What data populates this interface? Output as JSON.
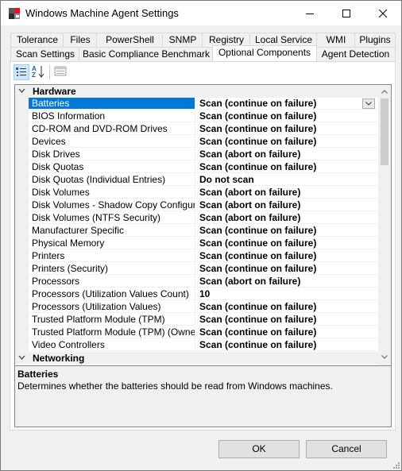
{
  "window": {
    "title": "Windows Machine Agent Settings",
    "icons": {
      "app": "app-icon",
      "minimize": "minimize-icon",
      "maximize": "maximize-icon",
      "close": "close-icon"
    }
  },
  "tabs": {
    "back_row": [
      "Tolerance",
      "Files",
      "PowerShell",
      "SNMP",
      "Registry",
      "Local Service",
      "WMI",
      "Plugins"
    ],
    "front_row": [
      "Scan Settings",
      "Basic Compliance Benchmark",
      "Optional Components",
      "Agent Detection"
    ],
    "active": "Optional Components"
  },
  "toolbar": {
    "categorized_icon": "categorized-view-icon",
    "alphabetical_icon": "alphabetical-sort-icon",
    "property_pages_icon": "property-pages-icon",
    "categorized_active": true
  },
  "property_grid": {
    "categories": [
      {
        "name": "Hardware",
        "expanded": true,
        "properties": [
          {
            "name": "Batteries",
            "value": "Scan (continue on failure)",
            "selected": true
          },
          {
            "name": "BIOS Information",
            "value": "Scan (continue on failure)"
          },
          {
            "name": "CD-ROM and DVD-ROM Drives",
            "value": "Scan (continue on failure)"
          },
          {
            "name": "Devices",
            "value": "Scan (continue on failure)"
          },
          {
            "name": "Disk Drives",
            "value": "Scan (abort on failure)"
          },
          {
            "name": "Disk Quotas",
            "value": "Scan (continue on failure)"
          },
          {
            "name": "Disk Quotas (Individual Entries)",
            "value": "Do not scan"
          },
          {
            "name": "Disk Volumes",
            "value": "Scan (abort on failure)"
          },
          {
            "name": "Disk Volumes - Shadow Copy Configuration",
            "value": "Scan (abort on failure)"
          },
          {
            "name": "Disk Volumes (NTFS Security)",
            "value": "Scan (abort on failure)"
          },
          {
            "name": "Manufacturer Specific",
            "value": "Scan (continue on failure)"
          },
          {
            "name": "Physical Memory",
            "value": "Scan (continue on failure)"
          },
          {
            "name": "Printers",
            "value": "Scan (continue on failure)"
          },
          {
            "name": "Printers (Security)",
            "value": "Scan (continue on failure)"
          },
          {
            "name": "Processors",
            "value": "Scan (abort on failure)"
          },
          {
            "name": "Processors (Utilization Values Count)",
            "value": "10"
          },
          {
            "name": "Processors (Utilization Values)",
            "value": "Scan (continue on failure)"
          },
          {
            "name": "Trusted Platform Module (TPM)",
            "value": "Scan (continue on failure)"
          },
          {
            "name": "Trusted Platform Module (TPM) (Owner Pas",
            "value": "Scan (continue on failure)"
          },
          {
            "name": "Video Controllers",
            "value": "Scan (continue on failure)"
          }
        ]
      },
      {
        "name": "Networking",
        "expanded": true,
        "properties": []
      }
    ]
  },
  "help": {
    "title": "Batteries",
    "description": "Determines whether the batteries should be read from Windows machines."
  },
  "buttons": {
    "ok": "OK",
    "cancel": "Cancel"
  },
  "colors": {
    "selection": "#0078d7",
    "category_bg": "#f0f0f0",
    "active_tab": "#ffffff"
  }
}
